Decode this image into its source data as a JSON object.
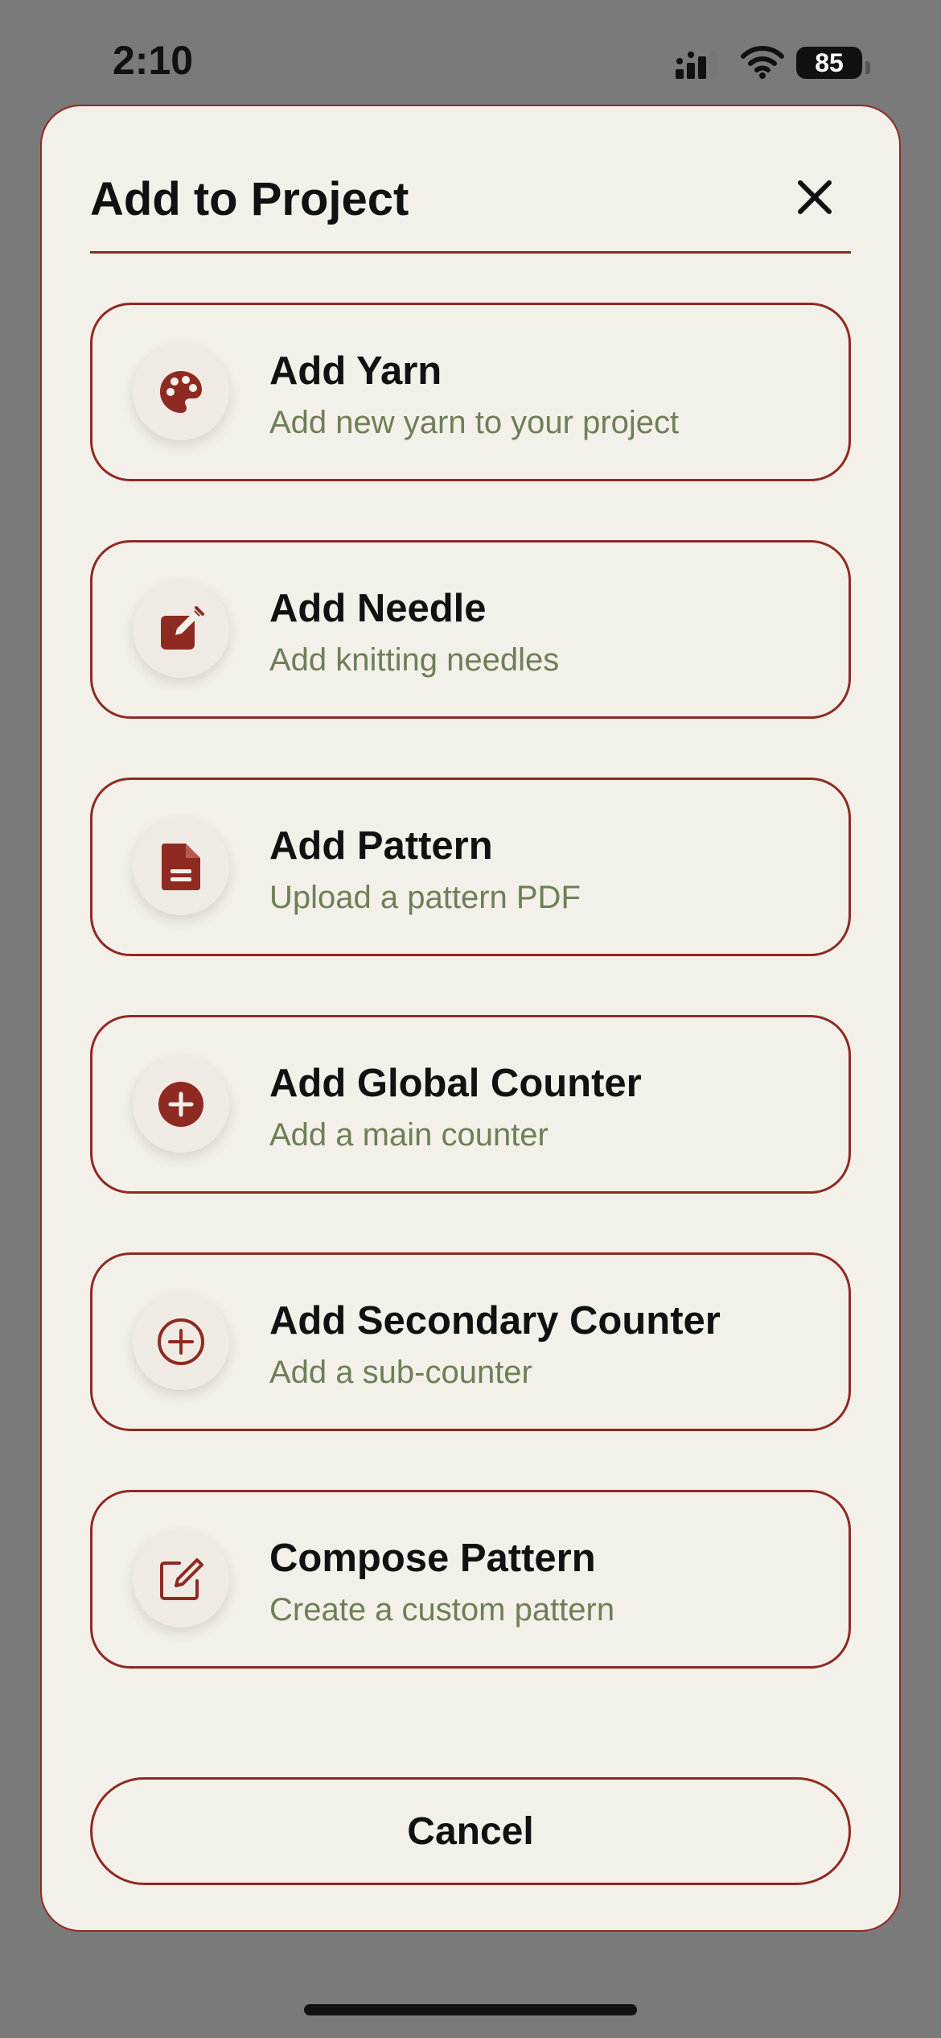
{
  "status_bar": {
    "time": "2:10",
    "battery": "85"
  },
  "sheet": {
    "title": "Add to Project",
    "close_icon": "close-icon"
  },
  "options": [
    {
      "title": "Add Yarn",
      "subtitle": "Add new yarn to your project",
      "icon": "palette-icon"
    },
    {
      "title": "Add Needle",
      "subtitle": "Add knitting needles",
      "icon": "edit-square-icon"
    },
    {
      "title": "Add Pattern",
      "subtitle": "Upload a pattern PDF",
      "icon": "document-icon"
    },
    {
      "title": "Add Global Counter",
      "subtitle": "Add a main counter",
      "icon": "plus-circle-filled-icon"
    },
    {
      "title": "Add Secondary Counter",
      "subtitle": "Add a sub-counter",
      "icon": "plus-circle-outline-icon"
    },
    {
      "title": "Compose Pattern",
      "subtitle": "Create a custom pattern",
      "icon": "edit-outline-icon"
    }
  ],
  "cancel_label": "Cancel",
  "colors": {
    "accent": "#8f2a22",
    "sheet_background": "#f3f0ea",
    "subtitle_text": "#6e7f55",
    "backdrop": "#7a7a7a"
  }
}
